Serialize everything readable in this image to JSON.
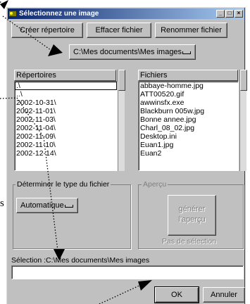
{
  "window": {
    "title": "Sélectionnez une image",
    "controls": [
      "minimize",
      "maximize",
      "close"
    ]
  },
  "toolbar": {
    "create_folder_label": "Créer répertoire",
    "delete_file_label": "Effacer fichier",
    "rename_file_label": "Renommer fichier"
  },
  "path_combo": {
    "value": "C:\\Mes documents\\Mes images"
  },
  "directories": {
    "header": "Répertoires",
    "items": [
      ".\\",
      "..\\",
      "2002-10-31\\",
      "2002-11-01\\",
      "2002-11-03\\",
      "2002-11-04\\",
      "2002-11-09\\",
      "2002-11-10\\",
      "2002-12-14\\"
    ]
  },
  "files": {
    "header": "Fichiers",
    "items": [
      "abbaye-homme.jpg",
      "ATT00520.gif",
      "awwinsfx.exe",
      "Blackburn 005w.jpg",
      "Bonne annee.jpg",
      "Charl_08_02.jpg",
      "Desktop.ini",
      "Euan1.jpg",
      "Euan2"
    ]
  },
  "file_type": {
    "group_label": "Déterminer le type du fichier",
    "value": "Automatique"
  },
  "preview": {
    "group_label": "Aperçu",
    "generate_label_line1": "générer",
    "generate_label_line2": "l'aperçu",
    "status": "Pas de sélection"
  },
  "selection": {
    "label": "Sélection :C:\\Mes documents\\Mes images",
    "value": ""
  },
  "actions": {
    "ok_label": "OK",
    "cancel_label": "Annuler"
  },
  "annotation": {
    "margin_letter": "s"
  }
}
